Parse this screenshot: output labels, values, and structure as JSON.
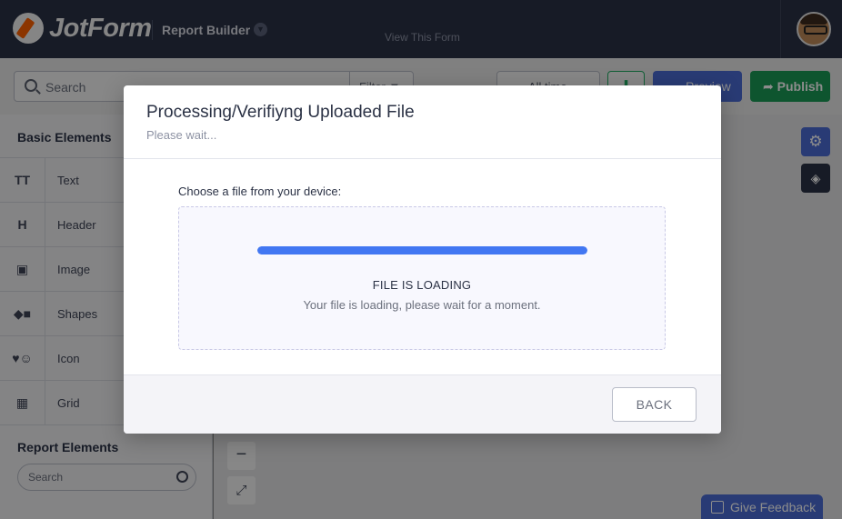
{
  "header": {
    "logo_text": "JotForm",
    "app_name": "Report Builder",
    "view_form_link": "View This Form"
  },
  "toolbar": {
    "search_placeholder": "Search",
    "filter_label": "Filter",
    "time_label": "All time",
    "preview_label": "Preview",
    "publish_label": "Publish"
  },
  "sidebar": {
    "basic_title": "Basic Elements",
    "items": [
      {
        "label": "Text",
        "icon": "text-icon",
        "glyph": "TT"
      },
      {
        "label": "Header",
        "icon": "header-icon",
        "glyph": "H"
      },
      {
        "label": "Image",
        "icon": "image-icon",
        "glyph": "▣"
      },
      {
        "label": "Shapes",
        "icon": "shapes-icon",
        "glyph": "◆■"
      },
      {
        "label": "Icon",
        "icon": "icon-icon",
        "glyph": "♥☺"
      },
      {
        "label": "Grid",
        "icon": "grid-icon",
        "glyph": "▦"
      }
    ],
    "report_title": "Report Elements",
    "report_search_placeholder": "Search"
  },
  "canvas": {
    "zoom_out_glyph": "−",
    "fullscreen_glyph": "⤢",
    "feedback_label": "Give Feedback"
  },
  "modal": {
    "title": "Processing/Verifiyng Uploaded File",
    "subtitle": "Please wait...",
    "choose_label": "Choose a file from your device:",
    "loading_title": "FILE IS LOADING",
    "loading_desc": "Your file is loading, please wait for a moment.",
    "progress": 1.0,
    "back_label": "BACK"
  },
  "colors": {
    "topbar": "#2b3245",
    "accent_blue": "#4277f2",
    "publish_green": "#1b9b57",
    "preview_blue": "#4b6cd6"
  }
}
